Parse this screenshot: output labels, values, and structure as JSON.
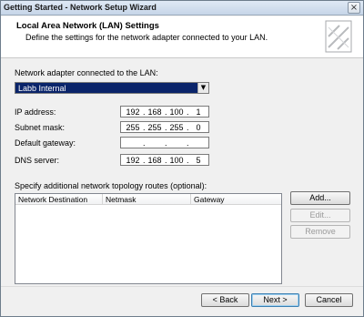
{
  "window": {
    "title": "Getting Started - Network Setup Wizard",
    "close_glyph": "×"
  },
  "header": {
    "title": "Local Area Network (LAN) Settings",
    "subtitle": "Define the settings for the network adapter connected to your LAN."
  },
  "adapter": {
    "label": "Network adapter connected to the LAN:",
    "selected": "Labb Internal"
  },
  "fields": {
    "ip_label": "IP address:",
    "ip": [
      "192",
      "168",
      "100",
      "1"
    ],
    "subnet_label": "Subnet mask:",
    "subnet": [
      "255",
      "255",
      "255",
      "0"
    ],
    "gateway_label": "Default gateway:",
    "gateway": [
      "",
      "",
      "",
      ""
    ],
    "dns_label": "DNS server:",
    "dns": [
      "192",
      "168",
      "100",
      "5"
    ]
  },
  "routes": {
    "label": "Specify additional network topology routes (optional):",
    "columns": [
      "Network Destination",
      "Netmask",
      "Gateway"
    ],
    "rows": []
  },
  "route_buttons": {
    "add": "Add...",
    "edit": "Edit...",
    "remove": "Remove"
  },
  "nav_buttons": {
    "back": "< Back",
    "next": "Next >",
    "cancel": "Cancel"
  },
  "icons": {
    "close": "close-icon",
    "dropdown": "chevron-down-icon",
    "header_graphic": "network-wizard-graphic-icon"
  }
}
